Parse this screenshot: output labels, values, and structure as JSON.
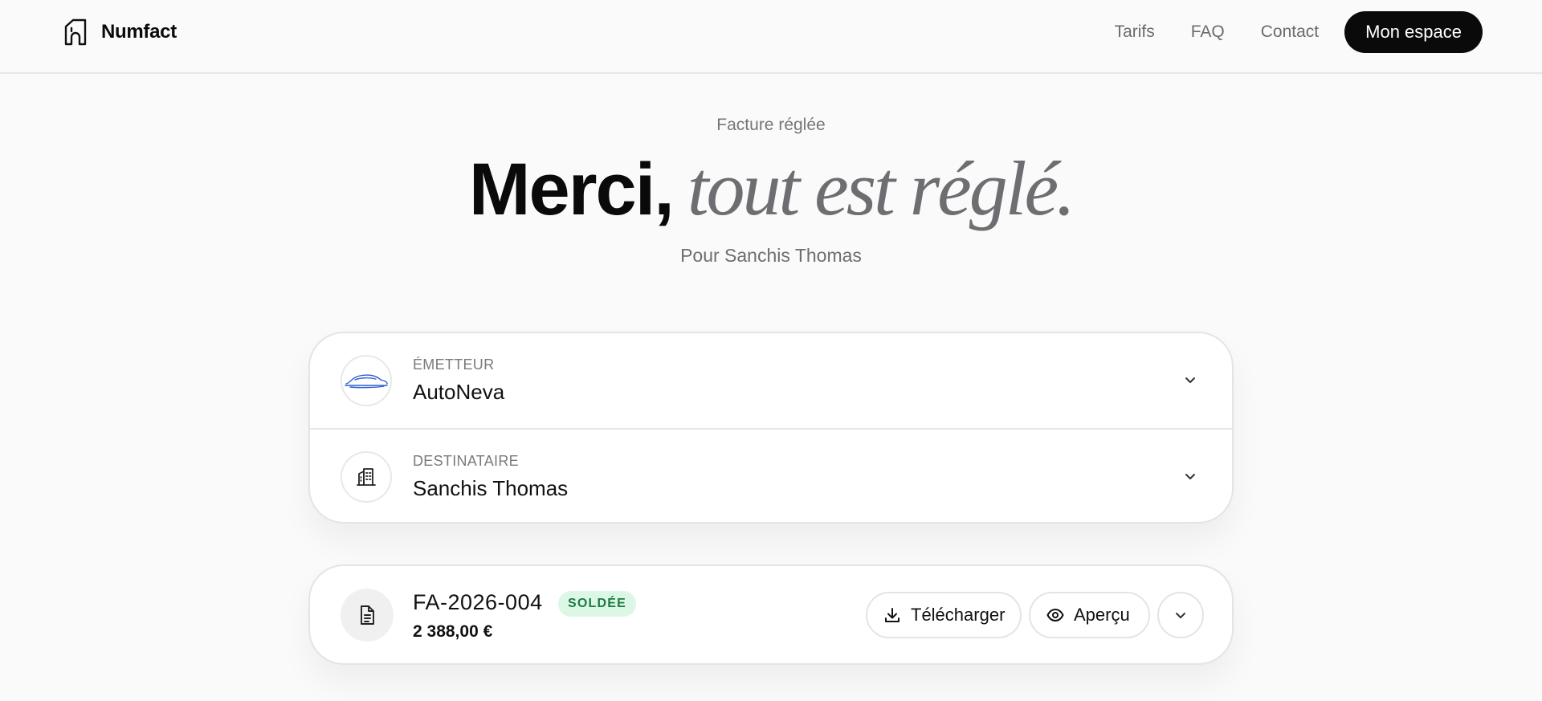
{
  "header": {
    "brand_name": "Numfact",
    "nav": [
      {
        "label": "Tarifs"
      },
      {
        "label": "FAQ"
      },
      {
        "label": "Contact"
      }
    ],
    "cta_label": "Mon espace"
  },
  "hero": {
    "eyebrow": "Facture réglée",
    "title_strong": "Merci,",
    "title_soft": "tout est réglé.",
    "subtitle": "Pour Sanchis Thomas"
  },
  "parties": {
    "issuer": {
      "label": "ÉMETTEUR",
      "name": "AutoNeva",
      "icon": "car-logo-icon"
    },
    "recipient": {
      "label": "DESTINATAIRE",
      "name": "Sanchis Thomas",
      "icon": "building-icon"
    }
  },
  "invoice": {
    "number": "FA-2026-004",
    "status": "SOLDÉE",
    "amount": "2 388,00 €",
    "download_label": "Télécharger",
    "preview_label": "Aperçu",
    "icons": {
      "document": "document-icon",
      "download": "download-icon",
      "preview": "eye-icon",
      "expand": "chevron-down-icon"
    }
  },
  "colors": {
    "background": "#fafafa",
    "text": "#0a0a0a",
    "muted": "#6e6e72",
    "cta": "#0a0a0a",
    "badge_bg": "#dcf7e5",
    "badge_text": "#1d7a44"
  }
}
